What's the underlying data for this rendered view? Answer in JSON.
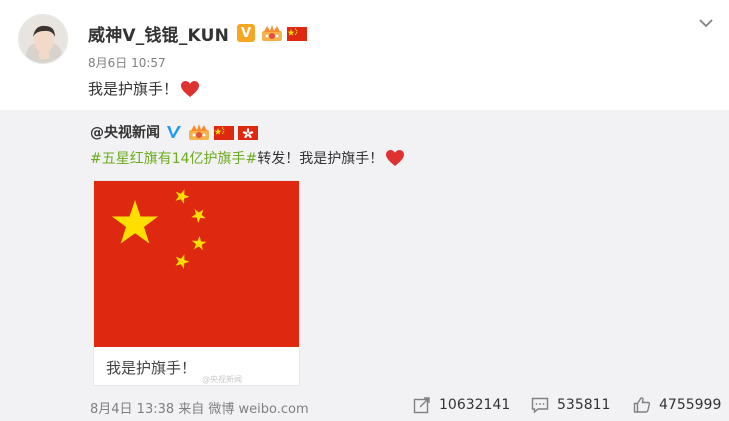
{
  "post": {
    "author_name": "威神V_钱锟_KUN",
    "verified_badge": "V",
    "time": "8月6日 10:57",
    "text": "我是护旗手！",
    "icons": [
      "avatar",
      "verified-v-badge",
      "crown-icon",
      "china-flag-icon",
      "heart-icon",
      "chevron-down-icon"
    ]
  },
  "repost": {
    "author": "@央视新闻",
    "hashtag": "#五星红旗有14亿护旗手#",
    "text_after": "转发！我是护旗手！",
    "image_caption": "我是护旗手！",
    "watermark": "@央视新闻",
    "date_source": "8月4日 13:38 来自 微博 weibo.com",
    "icons": [
      "verified-blue-v-icon",
      "crown-icon",
      "china-flag-icon",
      "hongkong-flag-icon",
      "heart-icon"
    ]
  },
  "stats": {
    "reposts": "10632141",
    "comments": "535811",
    "likes": "4755999"
  },
  "colors": {
    "hashtag_green": "#6cab1e",
    "flag_red": "#de2910",
    "star_yellow": "#ffde00",
    "repost_bg": "#f2f2f5",
    "muted_text": "#808080"
  }
}
